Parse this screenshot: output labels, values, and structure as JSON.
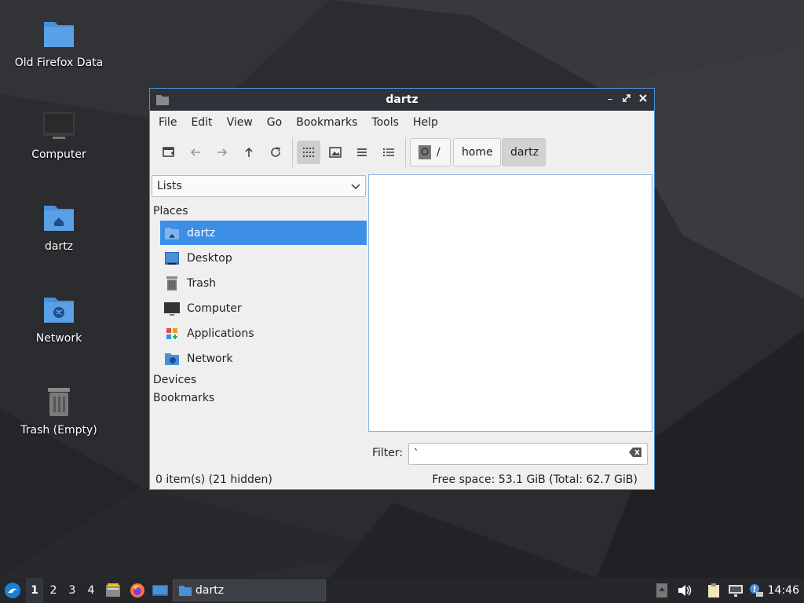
{
  "desktop": {
    "icons": [
      {
        "label": "Old Firefox Data",
        "icon": "folder-icon"
      },
      {
        "label": "Computer",
        "icon": "computer-icon"
      },
      {
        "label": "dartz",
        "icon": "home-folder-icon"
      },
      {
        "label": "Network",
        "icon": "network-folder-icon"
      },
      {
        "label": "Trash (Empty)",
        "icon": "trash-icon"
      }
    ]
  },
  "window": {
    "title": "dartz",
    "menu": [
      "File",
      "Edit",
      "View",
      "Go",
      "Bookmarks",
      "Tools",
      "Help"
    ],
    "toolbar": {
      "buttons": [
        "new-tab-icon",
        "back-icon",
        "forward-icon",
        "up-icon",
        "reload-icon",
        "icon-view-icon",
        "thumbnail-view-icon",
        "compact-view-icon",
        "detailed-list-view-icon"
      ],
      "active_view": "icon-view-icon"
    },
    "breadcrumb": {
      "root": "/",
      "items": [
        "home",
        "dartz"
      ]
    },
    "side_pane": {
      "mode": "Lists",
      "places_heading": "Places",
      "places": [
        {
          "label": "dartz",
          "icon": "home-icon",
          "selected": true
        },
        {
          "label": "Desktop",
          "icon": "desktop-icon",
          "selected": false
        },
        {
          "label": "Trash",
          "icon": "trash-icon",
          "selected": false
        },
        {
          "label": "Computer",
          "icon": "computer-icon",
          "selected": false
        },
        {
          "label": "Applications",
          "icon": "applications-icon",
          "selected": false
        },
        {
          "label": "Network",
          "icon": "network-icon",
          "selected": false
        }
      ],
      "devices_heading": "Devices",
      "bookmarks_heading": "Bookmarks"
    },
    "filter": {
      "label": "Filter:",
      "value": "`"
    },
    "status": {
      "items": "0 item(s) (21 hidden)",
      "free_space": "Free space: 53.1 GiB (Total: 62.7 GiB)"
    }
  },
  "taskbar": {
    "workspaces": [
      "1",
      "2",
      "3",
      "4"
    ],
    "active_workspace": "1",
    "launchers": [
      "file-manager-icon",
      "firefox-icon",
      "show-desktop-icon"
    ],
    "task_label": "dartz",
    "tray": [
      "volume-icon",
      "clipboard-icon",
      "network-status-icon",
      "update-notifier-icon"
    ],
    "clock": "14:46"
  },
  "colors": {
    "accent": "#3d8ee6",
    "titlebar": "#2f3238",
    "taskbar": "#25272b",
    "folder": "#4a90d9"
  }
}
